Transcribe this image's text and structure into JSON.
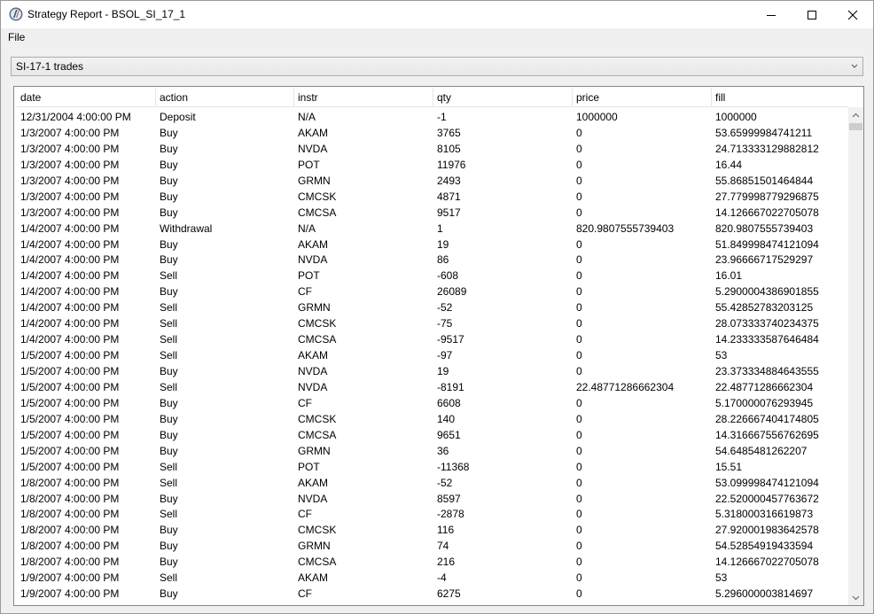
{
  "window": {
    "title": "Strategy Report - BSOL_SI_17_1"
  },
  "menu": {
    "file_label": "File"
  },
  "combo": {
    "selected": "SI-17-1 trades"
  },
  "table": {
    "columns": [
      "date",
      "action",
      "instr",
      "qty",
      "price",
      "fill"
    ],
    "rows": [
      [
        "12/31/2004 4:00:00 PM",
        "Deposit",
        "N/A",
        "-1",
        "1000000",
        "1000000"
      ],
      [
        "1/3/2007 4:00:00 PM",
        "Buy",
        "AKAM",
        "3765",
        "0",
        "53.65999984741211"
      ],
      [
        "1/3/2007 4:00:00 PM",
        "Buy",
        "NVDA",
        "8105",
        "0",
        "24.713333129882812"
      ],
      [
        "1/3/2007 4:00:00 PM",
        "Buy",
        "POT",
        "11976",
        "0",
        "16.44"
      ],
      [
        "1/3/2007 4:00:00 PM",
        "Buy",
        "GRMN",
        "2493",
        "0",
        "55.86851501464844"
      ],
      [
        "1/3/2007 4:00:00 PM",
        "Buy",
        "CMCSK",
        "4871",
        "0",
        "27.779998779296875"
      ],
      [
        "1/3/2007 4:00:00 PM",
        "Buy",
        "CMCSA",
        "9517",
        "0",
        "14.126667022705078"
      ],
      [
        "1/4/2007 4:00:00 PM",
        "Withdrawal",
        "N/A",
        "1",
        "820.9807555739403",
        "820.9807555739403"
      ],
      [
        "1/4/2007 4:00:00 PM",
        "Buy",
        "AKAM",
        "19",
        "0",
        "51.849998474121094"
      ],
      [
        "1/4/2007 4:00:00 PM",
        "Buy",
        "NVDA",
        "86",
        "0",
        "23.96666717529297"
      ],
      [
        "1/4/2007 4:00:00 PM",
        "Sell",
        "POT",
        "-608",
        "0",
        "16.01"
      ],
      [
        "1/4/2007 4:00:00 PM",
        "Buy",
        "CF",
        "26089",
        "0",
        "5.2900004386901855"
      ],
      [
        "1/4/2007 4:00:00 PM",
        "Sell",
        "GRMN",
        "-52",
        "0",
        "55.42852783203125"
      ],
      [
        "1/4/2007 4:00:00 PM",
        "Sell",
        "CMCSK",
        "-75",
        "0",
        "28.073333740234375"
      ],
      [
        "1/4/2007 4:00:00 PM",
        "Sell",
        "CMCSA",
        "-9517",
        "0",
        "14.233333587646484"
      ],
      [
        "1/5/2007 4:00:00 PM",
        "Sell",
        "AKAM",
        "-97",
        "0",
        "53"
      ],
      [
        "1/5/2007 4:00:00 PM",
        "Buy",
        "NVDA",
        "19",
        "0",
        "23.373334884643555"
      ],
      [
        "1/5/2007 4:00:00 PM",
        "Sell",
        "NVDA",
        "-8191",
        "22.48771286662304",
        "22.48771286662304"
      ],
      [
        "1/5/2007 4:00:00 PM",
        "Buy",
        "CF",
        "6608",
        "0",
        "5.170000076293945"
      ],
      [
        "1/5/2007 4:00:00 PM",
        "Buy",
        "CMCSK",
        "140",
        "0",
        "28.226667404174805"
      ],
      [
        "1/5/2007 4:00:00 PM",
        "Buy",
        "CMCSA",
        "9651",
        "0",
        "14.316667556762695"
      ],
      [
        "1/5/2007 4:00:00 PM",
        "Buy",
        "GRMN",
        "36",
        "0",
        "54.6485481262207"
      ],
      [
        "1/5/2007 4:00:00 PM",
        "Sell",
        "POT",
        "-11368",
        "0",
        "15.51"
      ],
      [
        "1/8/2007 4:00:00 PM",
        "Sell",
        "AKAM",
        "-52",
        "0",
        "53.099998474121094"
      ],
      [
        "1/8/2007 4:00:00 PM",
        "Buy",
        "NVDA",
        "8597",
        "0",
        "22.520000457763672"
      ],
      [
        "1/8/2007 4:00:00 PM",
        "Sell",
        "CF",
        "-2878",
        "0",
        "5.318000316619873"
      ],
      [
        "1/8/2007 4:00:00 PM",
        "Buy",
        "CMCSK",
        "116",
        "0",
        "27.920001983642578"
      ],
      [
        "1/8/2007 4:00:00 PM",
        "Buy",
        "GRMN",
        "74",
        "0",
        "54.52854919433594"
      ],
      [
        "1/8/2007 4:00:00 PM",
        "Buy",
        "CMCSA",
        "216",
        "0",
        "14.126667022705078"
      ],
      [
        "1/9/2007 4:00:00 PM",
        "Sell",
        "AKAM",
        "-4",
        "0",
        "53"
      ],
      [
        "1/9/2007 4:00:00 PM",
        "Buy",
        "CF",
        "6275",
        "0",
        "5.296000003814697"
      ]
    ]
  },
  "icons": {
    "app": "app-logo-icon",
    "minimize": "minimize-icon",
    "maximize": "maximize-icon",
    "close": "close-icon",
    "dropdown": "chevron-down-icon",
    "scroll_up": "scroll-up-arrow-icon",
    "scroll_down": "scroll-down-arrow-icon"
  }
}
